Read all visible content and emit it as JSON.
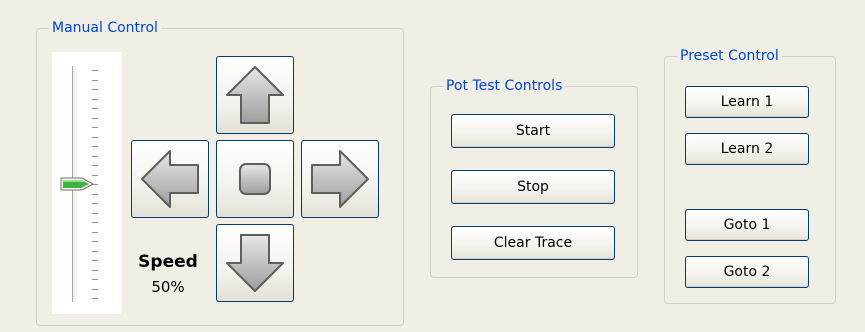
{
  "manual_control": {
    "title": "Manual Control",
    "speed_label": "Speed",
    "speed_value": "50%",
    "speed_level": 0.5,
    "buttons": [
      "up-arrow-icon",
      "left-arrow-icon",
      "stop-square-icon",
      "right-arrow-icon",
      "down-arrow-icon"
    ]
  },
  "pot_test": {
    "title": "Pot Test Controls",
    "start_label": "Start",
    "stop_label": "Stop",
    "clear_label": "Clear Trace"
  },
  "preset": {
    "title": "Preset Control",
    "learn1_label": "Learn 1",
    "learn2_label": "Learn 2",
    "goto1_label": "Goto 1",
    "goto2_label": "Goto 2"
  },
  "colors": {
    "group_title": "#0046d5",
    "button_border": "#003c74",
    "slider_thumb": "#3fb33f",
    "background": "#f0eee5"
  }
}
